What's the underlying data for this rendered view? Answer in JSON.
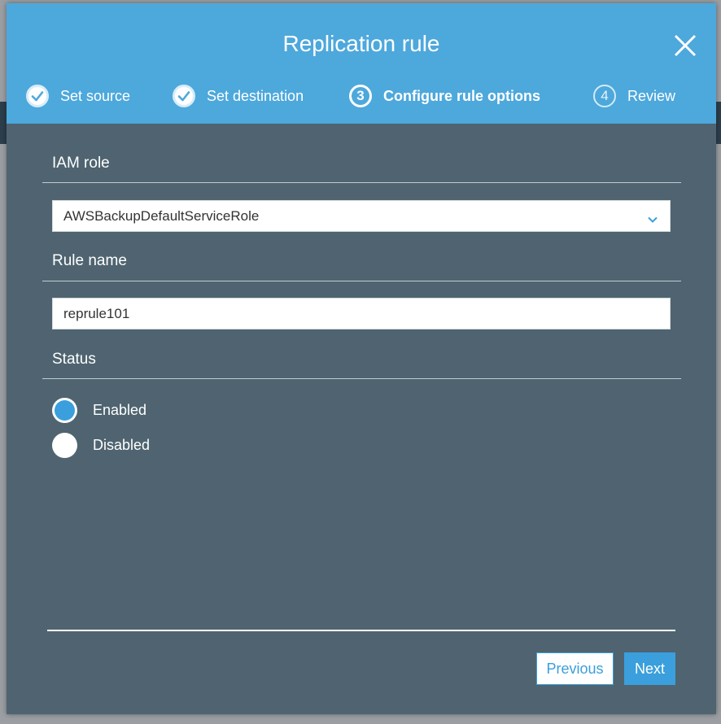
{
  "modal": {
    "title": "Replication rule",
    "close_icon": "close-icon"
  },
  "steps": [
    {
      "label": "Set source",
      "state": "done",
      "icon": "check-icon"
    },
    {
      "label": "Set destination",
      "state": "done",
      "icon": "check-icon"
    },
    {
      "label": "Configure rule options",
      "state": "active",
      "number": "3"
    },
    {
      "label": "Review",
      "state": "future",
      "number": "4"
    }
  ],
  "form": {
    "iam_role": {
      "label": "IAM role",
      "value": "AWSBackupDefaultServiceRole",
      "icon": "chevron-down-icon"
    },
    "rule_name": {
      "label": "Rule name",
      "value": "reprule101"
    },
    "status": {
      "label": "Status",
      "options": [
        {
          "label": "Enabled",
          "selected": true
        },
        {
          "label": "Disabled",
          "selected": false
        }
      ]
    }
  },
  "buttons": {
    "previous": "Previous",
    "next": "Next"
  },
  "colors": {
    "header": "#4da8dc",
    "body": "#4f6470",
    "accent": "#3a9fdc"
  }
}
